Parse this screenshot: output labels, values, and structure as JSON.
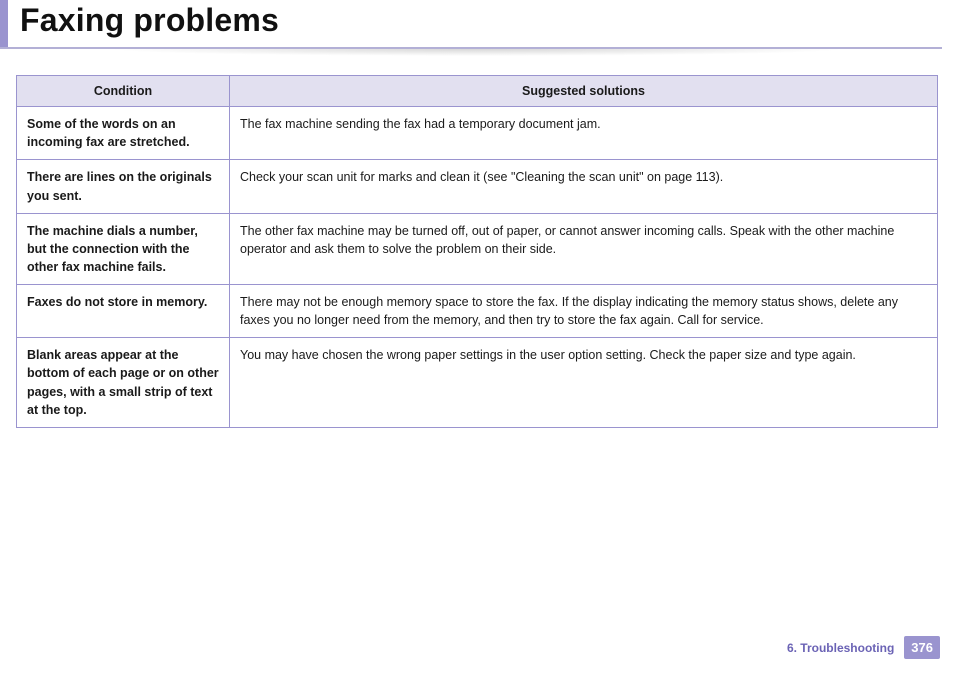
{
  "title": "Faxing problems",
  "columns": {
    "condition": "Condition",
    "solutions": "Suggested solutions"
  },
  "rows": [
    {
      "condition": "Some of the words on an incoming fax are stretched.",
      "solution": "The fax machine sending the fax had a temporary document jam."
    },
    {
      "condition": "There are lines on the originals you sent.",
      "solution": "Check your scan unit for marks and clean it (see \"Cleaning the scan unit\" on page 113)."
    },
    {
      "condition": "The machine dials a number, but the connection with the other fax machine fails.",
      "solution": "The other fax machine may be turned off, out of paper, or cannot answer incoming calls. Speak with the other machine operator and ask them to solve the problem on their side."
    },
    {
      "condition": "Faxes do not store in memory.",
      "solution": "There may not be enough memory space to store the fax. If the display indicating the memory status shows, delete any faxes you no longer need from the memory, and then try to store the fax again. Call for service."
    },
    {
      "condition": "Blank areas appear at the bottom of each page or on other pages, with a small strip of text at the top.",
      "solution": "You may have chosen the wrong paper settings in the user option setting. Check the paper size and type again."
    }
  ],
  "footer": {
    "chapter": "6.  Troubleshooting",
    "page": "376"
  }
}
